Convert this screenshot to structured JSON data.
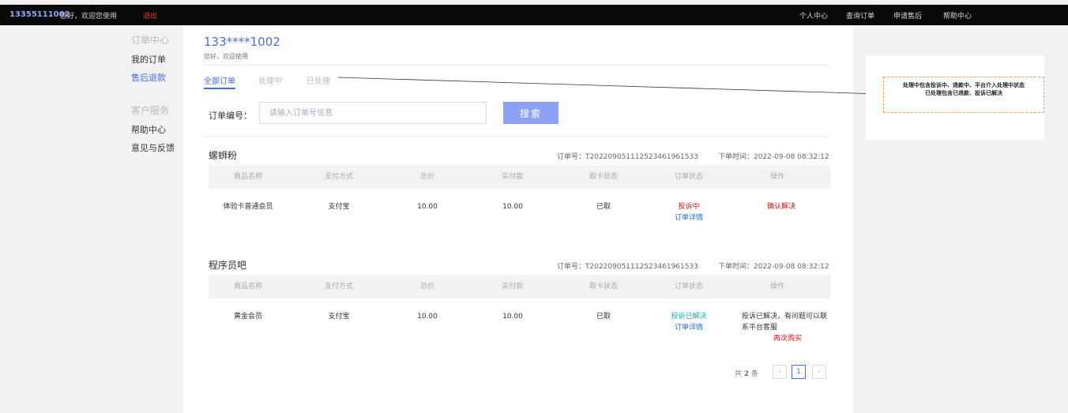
{
  "topbar": {
    "phone": "13355111002",
    "greeting": "您好，欢迎您使用",
    "logout": "退出",
    "nav": [
      "个人中心",
      "查询订单",
      "申请售后",
      "帮助中心"
    ]
  },
  "sidebar": {
    "section1_title": "订单中心",
    "my_orders": "我的订单",
    "after_sale": "售后退款",
    "section2_title": "客户服务",
    "help_center": "帮助中心",
    "feedback": "意见与反馈"
  },
  "user": {
    "masked_phone": "133****1002",
    "welcome": "您好，欢迎使用"
  },
  "tabs": [
    "全部订单",
    "处理中",
    "已处理"
  ],
  "search": {
    "label": "订单编号：",
    "placeholder": "请输入订单号信息",
    "button": "搜索"
  },
  "table_headers": [
    "商品名称",
    "支付方式",
    "总价",
    "实付款",
    "取卡状态",
    "订单状态",
    "操作"
  ],
  "orders": [
    {
      "shop": "螺蛳粉",
      "order_no": "订单号：T202209051112523461961533",
      "order_time": "下单时间：2022-09-08 08:32:12",
      "product": "体验卡普通会员",
      "payment": "支付宝",
      "total": "10.00",
      "paid": "10.00",
      "card_status": "已取",
      "status": "投诉中",
      "detail_link": "订单详情",
      "action": "确认解决",
      "action_note": ""
    },
    {
      "shop": "程序员吧",
      "order_no": "订单号：T202209051112523461961533",
      "order_time": "下单时间：2022-09-08 08:32:12",
      "product": "黄金会员",
      "payment": "支付宝",
      "total": "10.00",
      "paid": "10.00",
      "card_status": "已取",
      "status": "投诉已解决",
      "detail_link": "订单详情",
      "action_note": "投诉已解决，有问题可以联系平台客服",
      "action": "再次购买"
    }
  ],
  "pager": {
    "total_prefix": "共",
    "total_count": "2",
    "total_suffix": "条",
    "current": "1",
    "prev": "‹",
    "next": "›"
  },
  "annotation": {
    "line1": "处理中包含投诉中、退款中、平台介入处理中状态",
    "line2": "已处理包含已退款、投诉已解决"
  },
  "colors": {
    "accent": "#4a6ee0",
    "danger": "#e01010",
    "success": "#18b0a0",
    "button": "#8ea2f5"
  }
}
